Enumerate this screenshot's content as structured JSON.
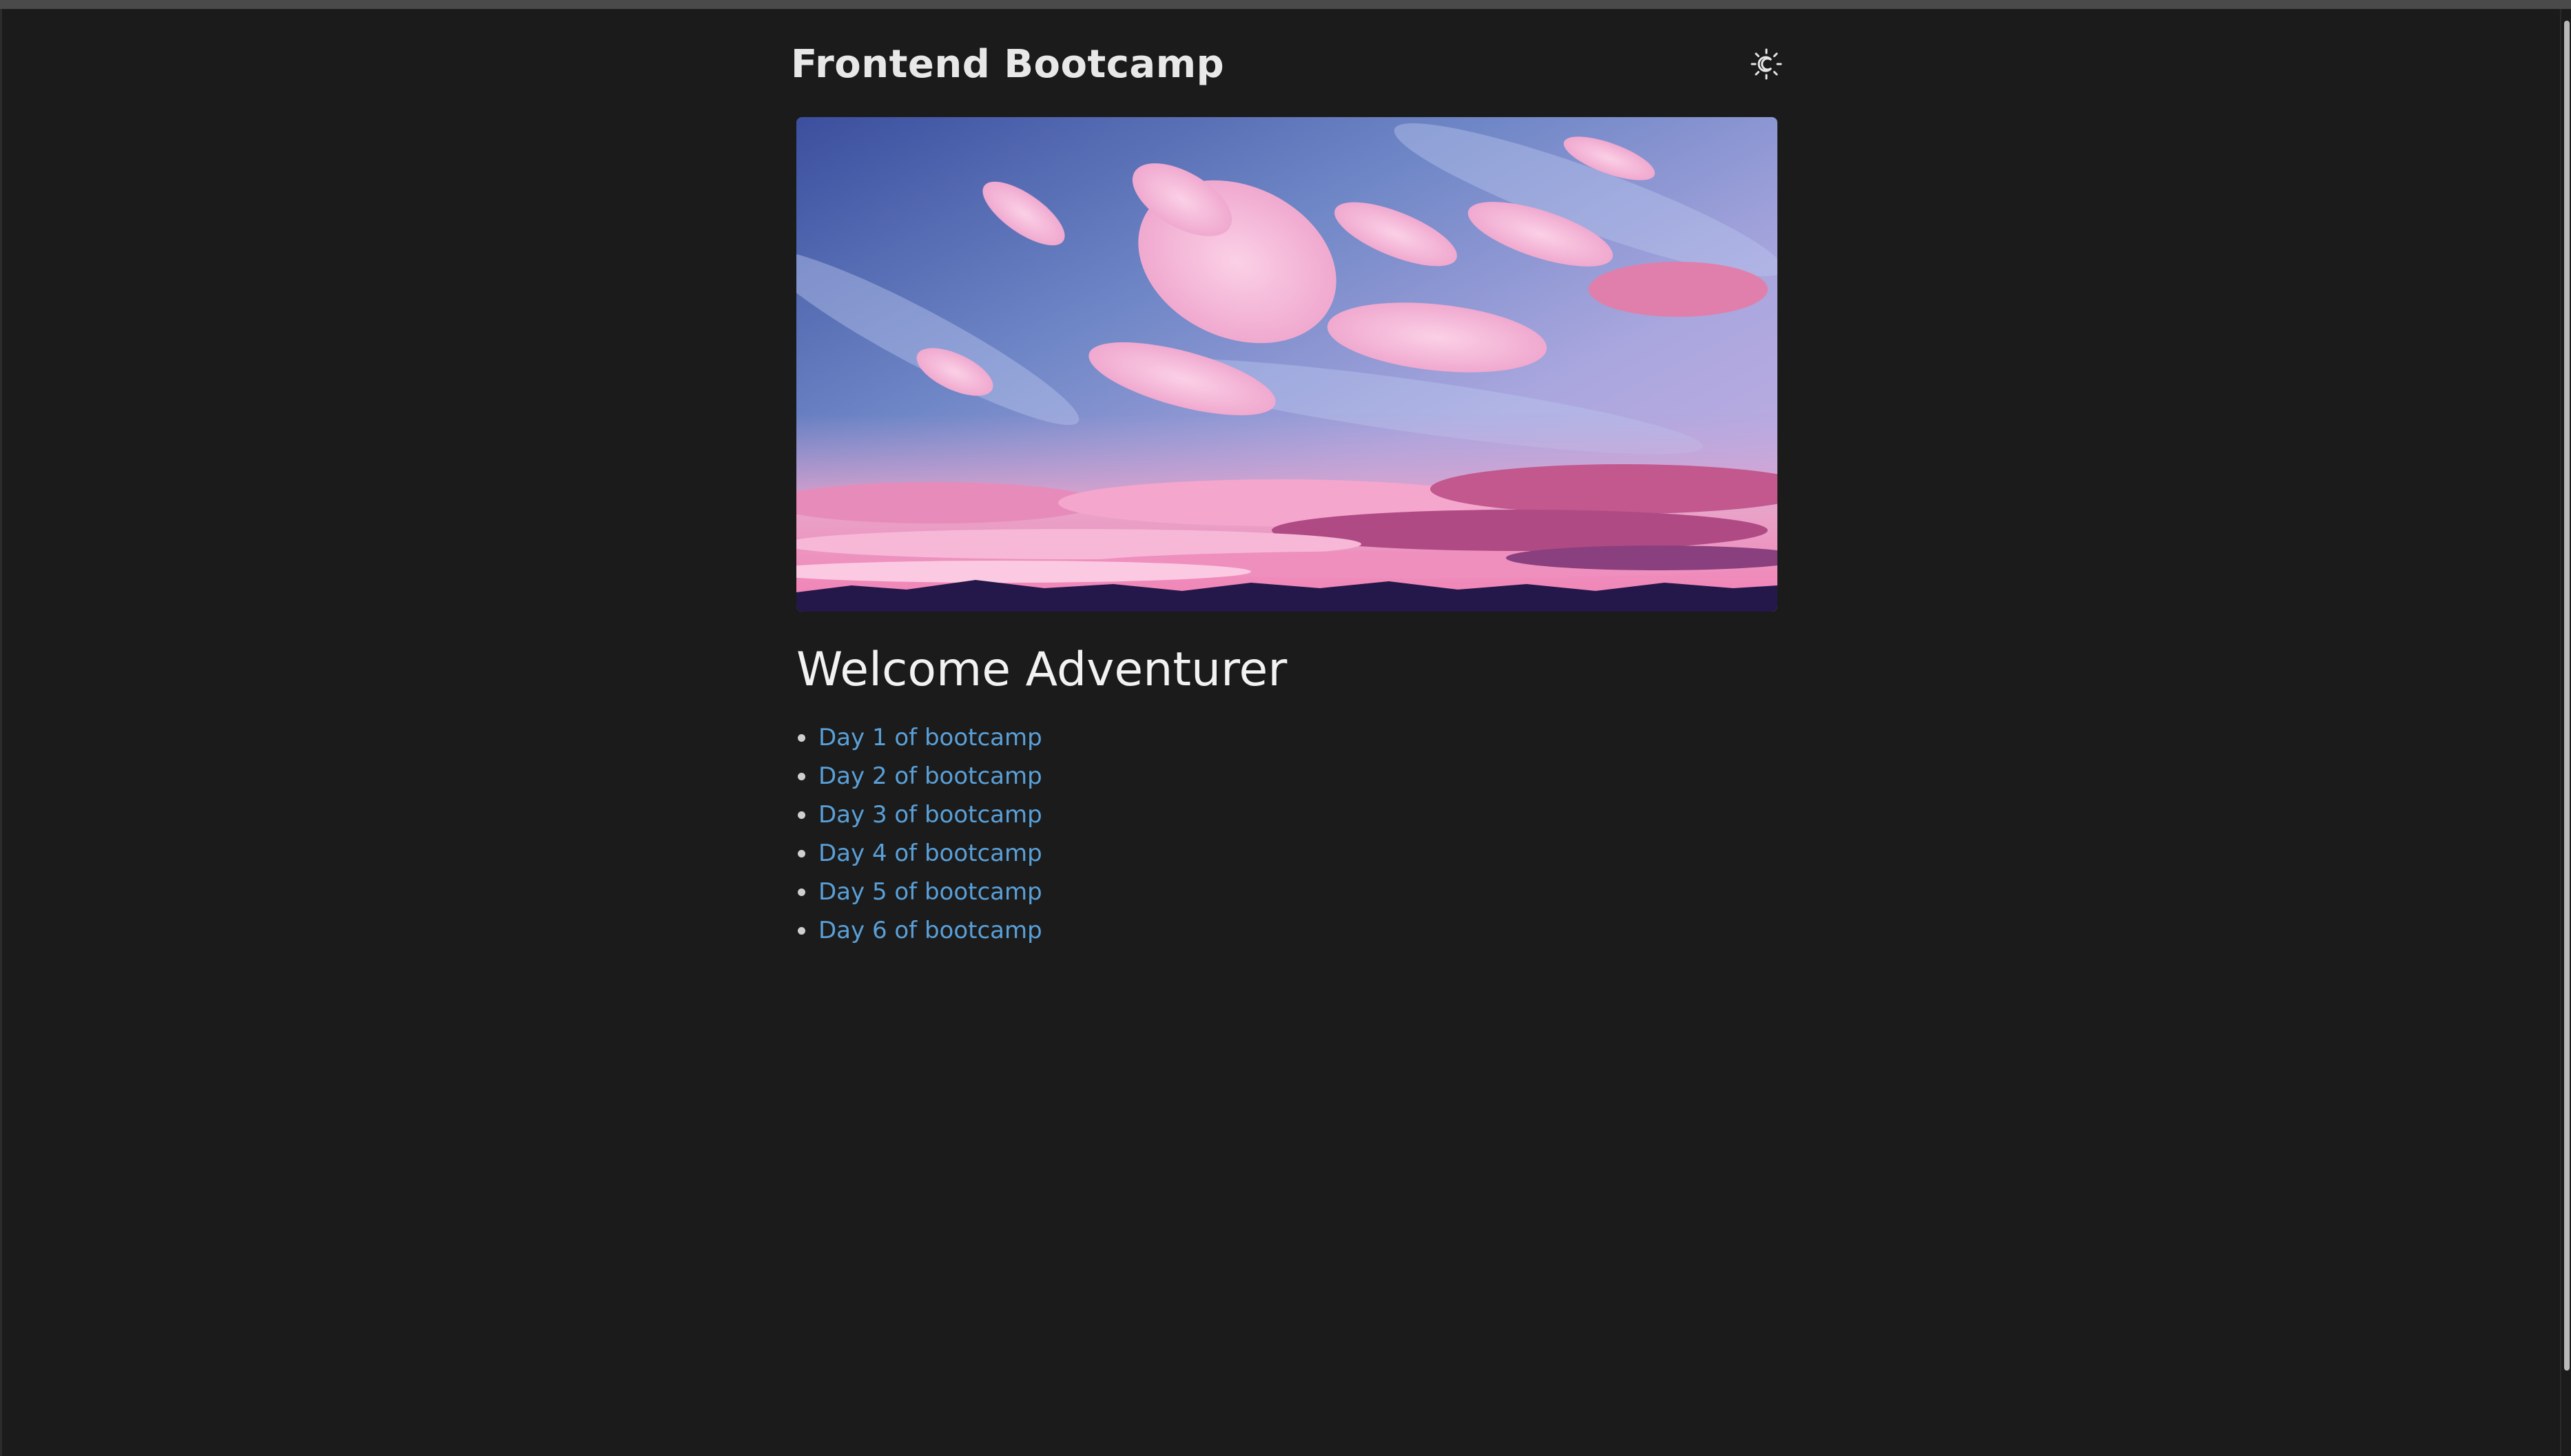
{
  "header": {
    "title": "Frontend Bootcamp",
    "theme_toggle_icon": "sun-moon-icon"
  },
  "hero": {
    "image_icon": "sky-clouds-illustration"
  },
  "main": {
    "heading": "Welcome Adventurer",
    "days": [
      {
        "label": "Day 1 of bootcamp"
      },
      {
        "label": "Day 2 of bootcamp"
      },
      {
        "label": "Day 3 of bootcamp"
      },
      {
        "label": "Day 4 of bootcamp"
      },
      {
        "label": "Day 5 of bootcamp"
      },
      {
        "label": "Day 6 of bootcamp"
      }
    ]
  },
  "colors": {
    "background": "#1b1b1b",
    "title": "#e8e8e8",
    "link": "#5aa0d8"
  }
}
